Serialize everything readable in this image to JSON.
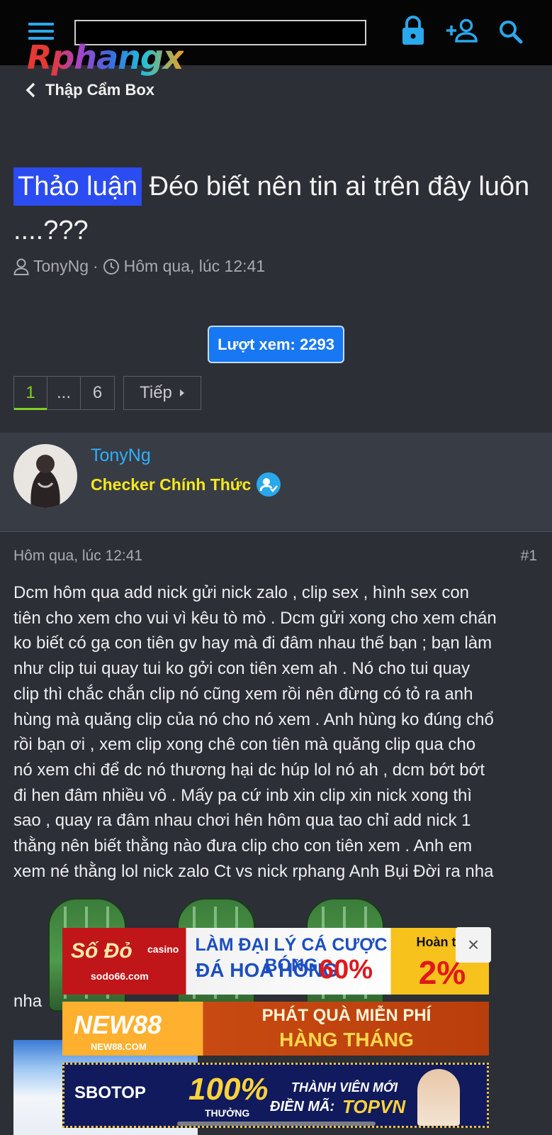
{
  "header": {
    "logo": {
      "first": "R",
      "rest": "phangx"
    },
    "search": {
      "value": "",
      "placeholder": ""
    },
    "icons": [
      "menu-icon",
      "lock-icon",
      "register-icon",
      "search-icon"
    ]
  },
  "breadcrumb": {
    "label": "Thập Cẩm Box"
  },
  "thread": {
    "prefix": "Thảo luận",
    "title": "Đéo biết nên tin ai trên đây luôn ....???",
    "author": "TonyNg",
    "separator": "·",
    "date": "Hôm qua, lúc 12:41",
    "views": "Lượt xem: 2293"
  },
  "pagination": {
    "pages": [
      "1",
      "...",
      "6"
    ],
    "current": "1",
    "next_label": "Tiếp"
  },
  "user": {
    "name": "TonyNg",
    "title": "Checker Chính Thức"
  },
  "post": {
    "date": "Hôm qua, lúc 12:41",
    "number": "#1",
    "body_lines": [
      "Dcm hôm qua add nick gửi nick zalo , clip sex , hình sex con",
      "tiên cho xem cho vui vì kêu tò mò . Dcm gửi xong cho xem chán",
      "ko biết có gạ con tiên gv hay mà đi đâm nhau thế bạn ; bạn làm",
      "như clip tui quay tui ko gởi con tiên xem ah . Nó cho tui quay",
      "clip thì chắc chắn clip nó cũng xem rồi nên đừng có tỏ ra anh",
      "hùng mà quăng clip của nó cho nó xem . Anh hùng ko đúng chổ",
      "rồi bạn ơi , xem clip xong chê con tiên mà quăng clip qua cho",
      "nó xem chi để dc nó thương hại dc húp lol nó ah , dcm bớt bớt",
      "đi hen đâm nhiều vô . Mấy pa cứ inb xin clip xin nick xong thì",
      "sao , quay ra đâm nhau chơi hên hôm qua tao chỉ add nick 1",
      "thằng nên biết thằng nào đưa clip cho con tiên xem . Anh em",
      "xem né thằng lol nick zalo Ct vs nick rphang Anh Bụi Đời ra nha"
    ],
    "trailing_text": "nha"
  },
  "ads": [
    {
      "brand": "Số Đỏ",
      "brand_sub": "casino",
      "domain": "sodo66.com",
      "line1": "LÀM ĐẠI LÝ CÁ CƯỢC BÓNG",
      "line2_a": "ĐÁ HOA HỒNG",
      "line2_b": "60%",
      "side_top": "Hoàn trả",
      "side_big": "2%"
    },
    {
      "brand": "NEW88",
      "domain": "NEW88.COM",
      "line1": "PHÁT QUÀ MIỄN PHÍ",
      "line2": "HÀNG THÁNG"
    },
    {
      "brand": "SBOTOP",
      "big": "100%",
      "big_sub": "THƯỞNG",
      "line1": "THÀNH VIÊN MỚI",
      "line2_a": "ĐIỀN MÃ:",
      "line2_b": "TOPVN"
    }
  ],
  "ad_close_label": "×",
  "colors": {
    "accent": "#2fb0ff",
    "prefix_bg": "#2b4cf0",
    "views_bg": "#1877f2",
    "user_title": "#f7e81c",
    "active_page": "#7ed321"
  }
}
